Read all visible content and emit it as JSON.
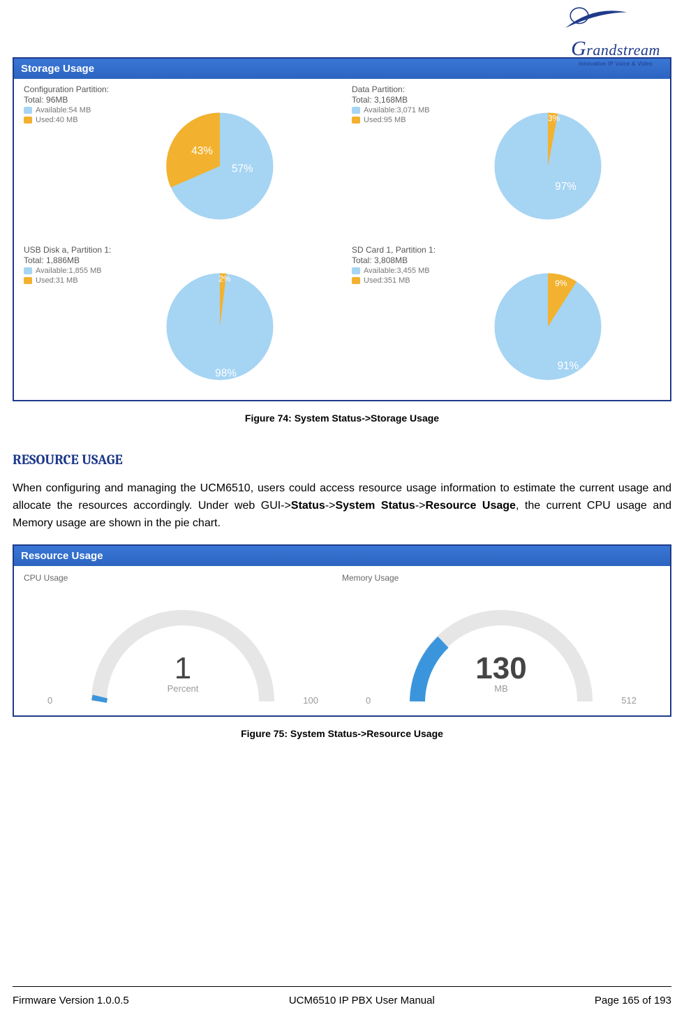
{
  "logo": {
    "brand": "Grandstream",
    "tagline": "Innovative IP Voice & Video"
  },
  "storage_panel": {
    "header": "Storage Usage"
  },
  "figure74_caption": "Figure 74: System Status->Storage Usage",
  "section_heading": "RESOURCE USAGE",
  "paragraph_parts": {
    "p1": "When configuring and managing the UCM6510, users could access resource usage information to estimate the current usage and allocate the resources accordingly. Under web GUI->",
    "b1": "Status",
    "s1": "->",
    "b2": "System Status",
    "s2": "->",
    "b3": "Resource Usage",
    "p2": ", the current CPU usage and Memory usage are shown in the pie chart."
  },
  "resource_panel": {
    "header": "Resource Usage"
  },
  "figure75_caption": "Figure 75: System Status->Resource Usage",
  "footer": {
    "left": "Firmware Version 1.0.0.5",
    "center": "UCM6510 IP PBX User Manual",
    "right": "Page 165 of 193"
  },
  "chart_data": [
    {
      "type": "pie",
      "title": "Configuration Partition:",
      "subtitle": "Total: 96MB",
      "series": [
        {
          "name": "Available",
          "label": "Available:54 MB",
          "value": 57,
          "color": "#a6d4f3"
        },
        {
          "name": "Used",
          "label": "Used:40 MB",
          "value": 43,
          "color": "#f2b22f"
        }
      ]
    },
    {
      "type": "pie",
      "title": "Data Partition:",
      "subtitle": "Total: 3,168MB",
      "series": [
        {
          "name": "Available",
          "label": "Available:3,071 MB",
          "value": 97,
          "color": "#a6d4f3"
        },
        {
          "name": "Used",
          "label": "Used:95 MB",
          "value": 3,
          "color": "#f2b22f"
        }
      ]
    },
    {
      "type": "pie",
      "title": "USB Disk a, Partition 1:",
      "subtitle": "Total: 1,886MB",
      "series": [
        {
          "name": "Available",
          "label": "Available:1,855 MB",
          "value": 98,
          "color": "#a6d4f3"
        },
        {
          "name": "Used",
          "label": "Used:31 MB",
          "value": 2,
          "color": "#f2b22f"
        }
      ]
    },
    {
      "type": "pie",
      "title": "SD Card 1, Partition 1:",
      "subtitle": "Total: 3,808MB",
      "series": [
        {
          "name": "Available",
          "label": "Available:3,455 MB",
          "value": 91,
          "color": "#a6d4f3"
        },
        {
          "name": "Used",
          "label": "Used:351 MB",
          "value": 9,
          "color": "#f2b22f"
        }
      ]
    },
    {
      "type": "gauge",
      "title": "CPU Usage",
      "value": 1,
      "unit": "Percent",
      "min": 0,
      "max": 100
    },
    {
      "type": "gauge",
      "title": "Memory Usage",
      "value": 130,
      "unit": "MB",
      "min": 0,
      "max": 512
    }
  ]
}
